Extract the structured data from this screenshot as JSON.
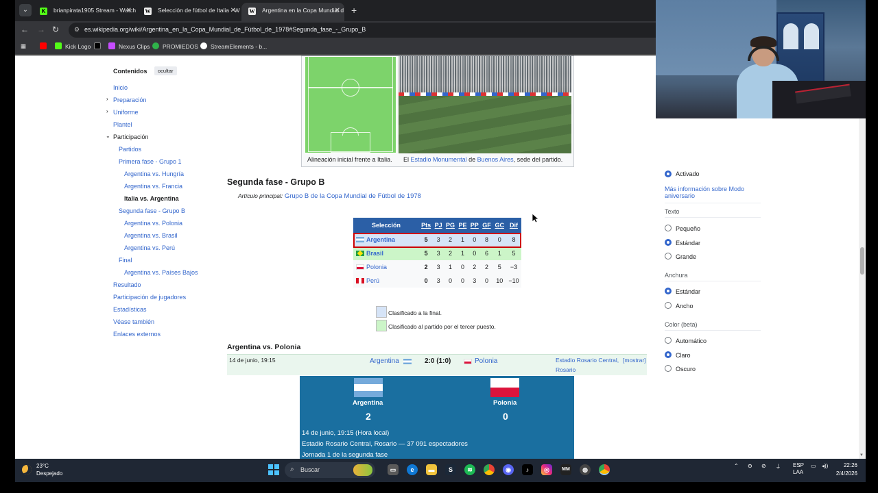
{
  "browser": {
    "tabs": [
      {
        "label": "brianpirata1905 Stream - Watch",
        "favicon": "kick-icon"
      },
      {
        "label": "Selección de fútbol de Italia - W",
        "favicon": "wikipedia-icon"
      },
      {
        "label": "Argentina en la Copa Mundial d",
        "favicon": "wikipedia-icon",
        "active": true
      }
    ],
    "url": "es.wikipedia.org/wiki/Argentina_en_la_Copa_Mundial_de_Fútbol_de_1978#Segunda_fase_-_Grupo_B",
    "bookmarks": [
      "Kick Logo",
      "Nexus Clips",
      "PROMIEDOS",
      "StreamElements - b..."
    ]
  },
  "toc": {
    "title": "Contenidos",
    "hide_label": "ocultar",
    "items": [
      {
        "label": "Inicio"
      },
      {
        "label": "Preparación"
      },
      {
        "label": "Uniforme"
      },
      {
        "label": "Plantel"
      },
      {
        "label": "Participación"
      },
      {
        "label": "Partidos"
      },
      {
        "label": "Primera fase - Grupo 1"
      },
      {
        "label": "Argentina vs. Hungría"
      },
      {
        "label": "Argentina vs. Francia"
      },
      {
        "label": "Italia vs. Argentina"
      },
      {
        "label": "Segunda fase - Grupo B"
      },
      {
        "label": "Argentina vs. Polonia"
      },
      {
        "label": "Argentina vs. Brasil"
      },
      {
        "label": "Argentina vs. Perú"
      },
      {
        "label": "Final"
      },
      {
        "label": "Argentina vs. Países Bajos"
      },
      {
        "label": "Resultado"
      },
      {
        "label": "Participación de jugadores"
      },
      {
        "label": "Estadísticas"
      },
      {
        "label": "Véase también"
      },
      {
        "label": "Enlaces externos"
      }
    ]
  },
  "figure": {
    "caption_left": "Alineación inicial frente a Italia.",
    "caption_right_prefix": "El",
    "caption_link1": "Estadio Monumental",
    "caption_mid": "de",
    "caption_link2": "Buenos Aires",
    "caption_suffix": ", sede del partido."
  },
  "section": {
    "title": "Segunda fase - Grupo B",
    "main_article_label": "Artículo principal:",
    "main_article_link": "Grupo B de la Copa Mundial de Fútbol de 1978"
  },
  "standings": {
    "headers": [
      "Selección",
      "Pts",
      "PJ",
      "PG",
      "PE",
      "PP",
      "GF",
      "GC",
      "Dif"
    ],
    "rows": [
      {
        "team": "Argentina",
        "cells": [
          "5",
          "3",
          "2",
          "1",
          "0",
          "8",
          "0",
          "8"
        ]
      },
      {
        "team": "Brasil",
        "cells": [
          "5",
          "3",
          "2",
          "1",
          "0",
          "6",
          "1",
          "5"
        ]
      },
      {
        "team": "Polonia",
        "cells": [
          "2",
          "3",
          "1",
          "0",
          "2",
          "2",
          "5",
          "−3"
        ]
      },
      {
        "team": "Perú",
        "cells": [
          "0",
          "3",
          "0",
          "0",
          "3",
          "0",
          "10",
          "−10"
        ]
      }
    ],
    "legend": [
      {
        "label": "Clasificado a la final.",
        "color": "#d6e4f7"
      },
      {
        "label": "Clasificado al partido por el tercer puesto.",
        "color": "#ccf5c8"
      }
    ]
  },
  "match": {
    "heading": "Argentina vs. Polonia",
    "date": "14 de junio, 19:15",
    "home": "Argentina",
    "score": "2:0 (1:0)",
    "away": "Polonia",
    "venue_line1": "Estadio Rosario Central,",
    "venue_line2": "Rosario",
    "show_label": "[mostrar]",
    "home_goals": "2",
    "away_goals": "0",
    "info1": "14 de junio, 19:15 (Hora local)",
    "info2": "Estadio Rosario Central, Rosario — 37 091 espectadores",
    "info3": "Jornada 1 de la segunda fase"
  },
  "appearance": {
    "first_option": "Activado",
    "more_info": "Más información sobre Modo aniversario",
    "text_label": "Texto",
    "text_options": [
      "Pequeño",
      "Estándar",
      "Grande"
    ],
    "text_selected": 1,
    "width_label": "Anchura",
    "width_options": [
      "Estándar",
      "Ancho"
    ],
    "width_selected": 0,
    "color_label": "Color (beta)",
    "color_options": [
      "Automático",
      "Claro",
      "Oscuro"
    ],
    "color_selected": 1
  },
  "taskbar": {
    "temperature": "23°C",
    "weather": "Despejado",
    "search_label": "Buscar",
    "lang1": "ESP",
    "lang2": "LAA",
    "time": "22:26",
    "date": "2/4/2026"
  }
}
